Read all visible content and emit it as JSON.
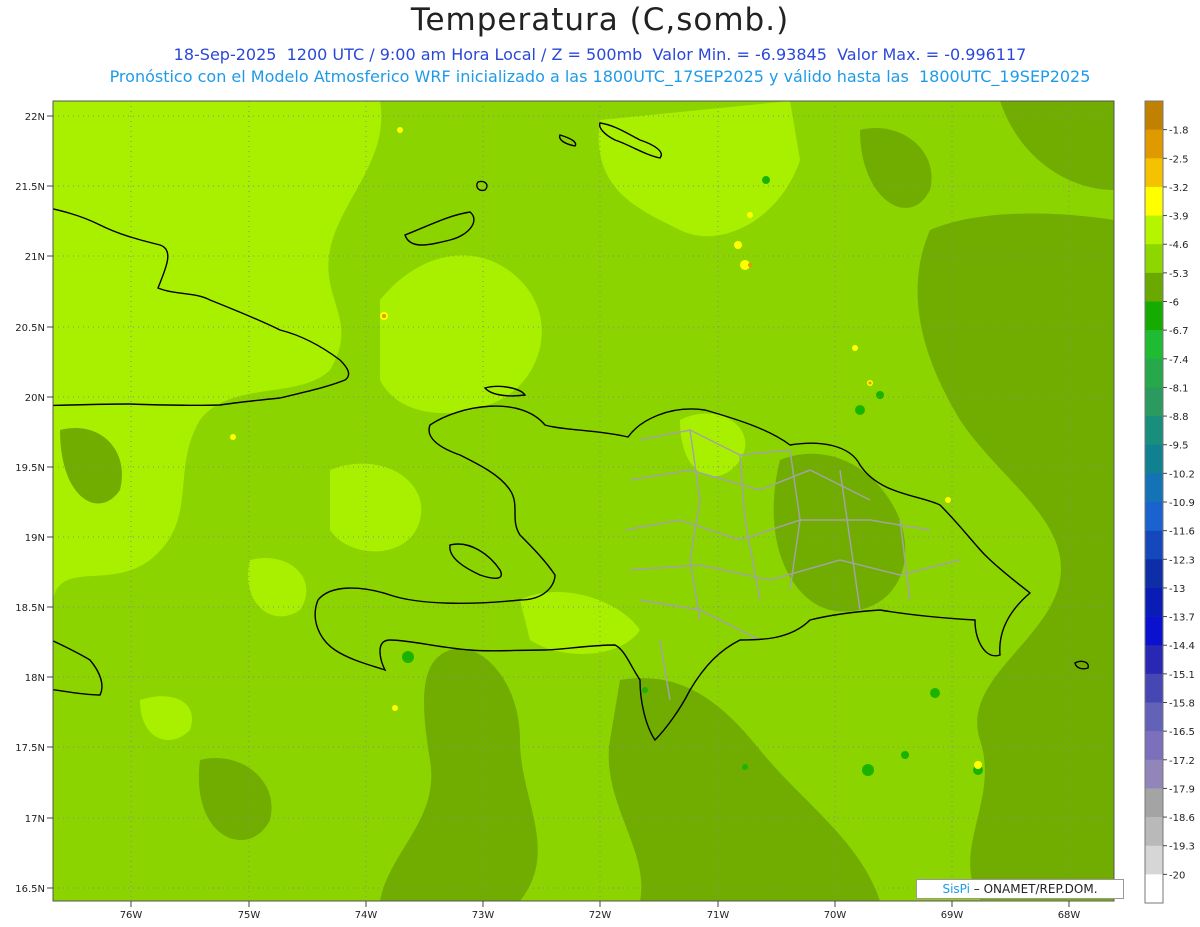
{
  "header": {
    "title": "Temperatura (C,somb.)",
    "line1": "18-Sep-2025  1200 UTC / 9:00 am Hora Local / Z = 500mb  Valor Min. = -6.93845  Valor Max. = -0.996117",
    "line2": "Pronóstico con el Modelo Atmosferico WRF inicializado a las 1800UTC_17SEP2025 y válido hasta las  1800UTC_19SEP2025"
  },
  "axes": {
    "lat_labels": [
      "22N",
      "21.5N",
      "21N",
      "20.5N",
      "20N",
      "19.5N",
      "19N",
      "18.5N",
      "18N",
      "17.5N",
      "17N",
      "16.5N"
    ],
    "lon_labels": [
      "76W",
      "75W",
      "74W",
      "73W",
      "72W",
      "71W",
      "70W",
      "69W",
      "68W"
    ]
  },
  "legend": {
    "labels": [
      "-1.8",
      "-2.5",
      "-3.2",
      "-3.9",
      "-4.6",
      "-5.3",
      "-6",
      "-6.7",
      "-7.4",
      "-8.1",
      "-8.8",
      "-9.5",
      "-10.2",
      "-10.9",
      "-11.6",
      "-12.3",
      "-13",
      "-13.7",
      "-14.4",
      "-15.1",
      "-15.8",
      "-16.5",
      "-17.2",
      "-17.9",
      "-18.6",
      "-19.3",
      "-20"
    ],
    "colors": [
      "#c08000",
      "#e09a00",
      "#f4c200",
      "#ffff00",
      "#b6f500",
      "#8ed600",
      "#6aaa00",
      "#15ab00",
      "#1fbb33",
      "#25a94a",
      "#2a9a5e",
      "#188e7c",
      "#0f8191",
      "#1472b6",
      "#1a63cf",
      "#1549bb",
      "#0d2ea6",
      "#091cb6",
      "#0b12cf",
      "#2828b5",
      "#4747b4",
      "#6262b8",
      "#7c6fbb",
      "#9185ba",
      "#a4a4a4",
      "#b9b9b9",
      "#d6d6d6",
      "#ffffff"
    ]
  },
  "credit": {
    "brand": "SisPi",
    "org": " – ONAMET/REP.DOM."
  },
  "colors": {
    "field_main": "#8bd400",
    "field_light": "#a9f000",
    "field_dark": "#70ad00",
    "field_green": "#1ab300",
    "field_yellow": "#ffff00",
    "field_orange": "#e09a00"
  }
}
